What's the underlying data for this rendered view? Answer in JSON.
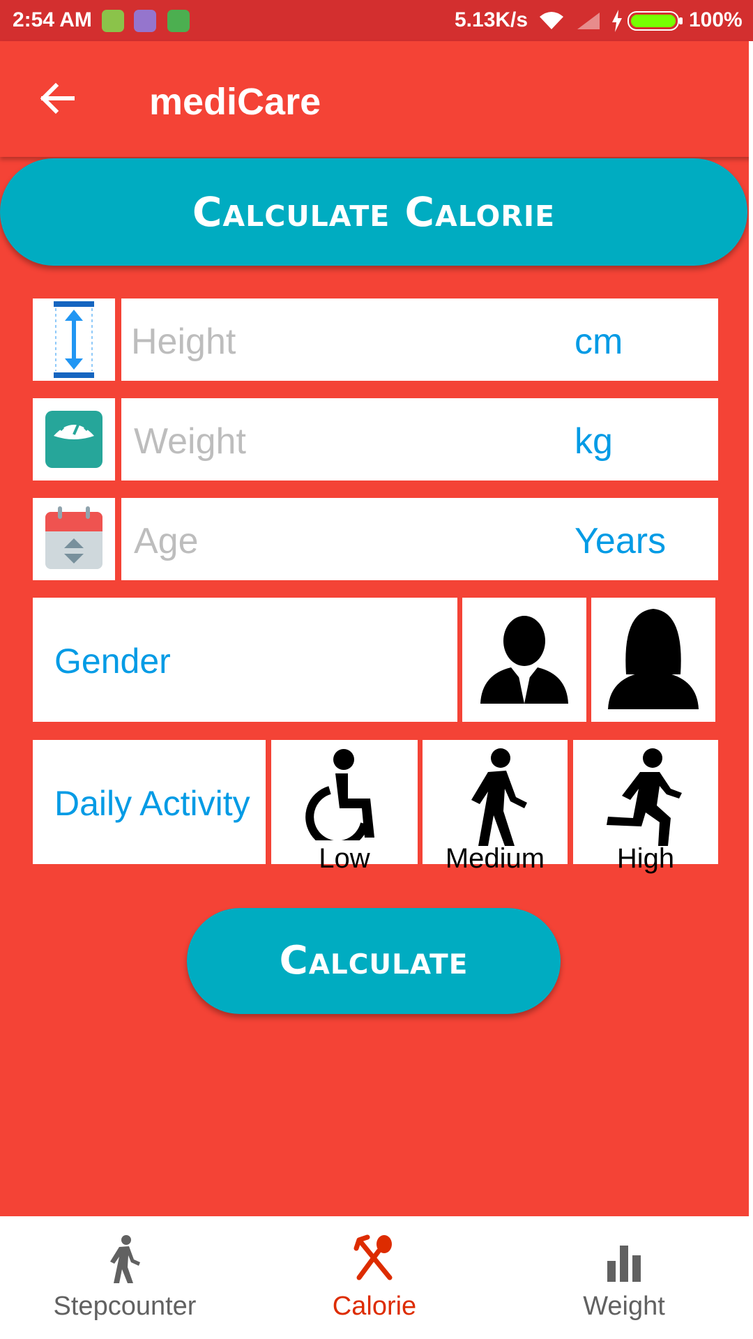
{
  "status_bar": {
    "time": "2:54 AM",
    "network_speed": "5.13K/s",
    "battery_percent": "100%"
  },
  "app_bar": {
    "title": "mediCare",
    "back_icon": "arrow-back-icon"
  },
  "header_button": {
    "label": "Calculate Calorie"
  },
  "form": {
    "height": {
      "placeholder": "Height",
      "unit": "cm",
      "icon": "height-icon"
    },
    "weight": {
      "placeholder": "Weight",
      "unit": "kg",
      "icon": "scale-icon"
    },
    "age": {
      "placeholder": "Age",
      "unit": "Years",
      "icon": "calendar-icon"
    },
    "gender": {
      "label": "Gender",
      "options": [
        "male-icon",
        "female-icon"
      ]
    },
    "activity": {
      "label": "Daily Activity",
      "levels": [
        {
          "label": "Low",
          "icon": "wheelchair-icon"
        },
        {
          "label": "Medium",
          "icon": "walking-icon"
        },
        {
          "label": "High",
          "icon": "running-icon"
        }
      ]
    }
  },
  "calculate_button": {
    "label": "Calculate"
  },
  "bottom_nav": {
    "items": [
      {
        "label": "Stepcounter",
        "icon": "walking-icon",
        "active": false
      },
      {
        "label": "Calorie",
        "icon": "fork-spoon-icon",
        "active": true
      },
      {
        "label": "Weight",
        "icon": "bar-chart-icon",
        "active": false
      }
    ],
    "active_color": "#DD2C00",
    "inactive_color": "#616161"
  },
  "colors": {
    "primary": "#F44336",
    "status_bar": "#D32F2F",
    "accent": "#00ACC1",
    "link_blue": "#039BE5"
  }
}
